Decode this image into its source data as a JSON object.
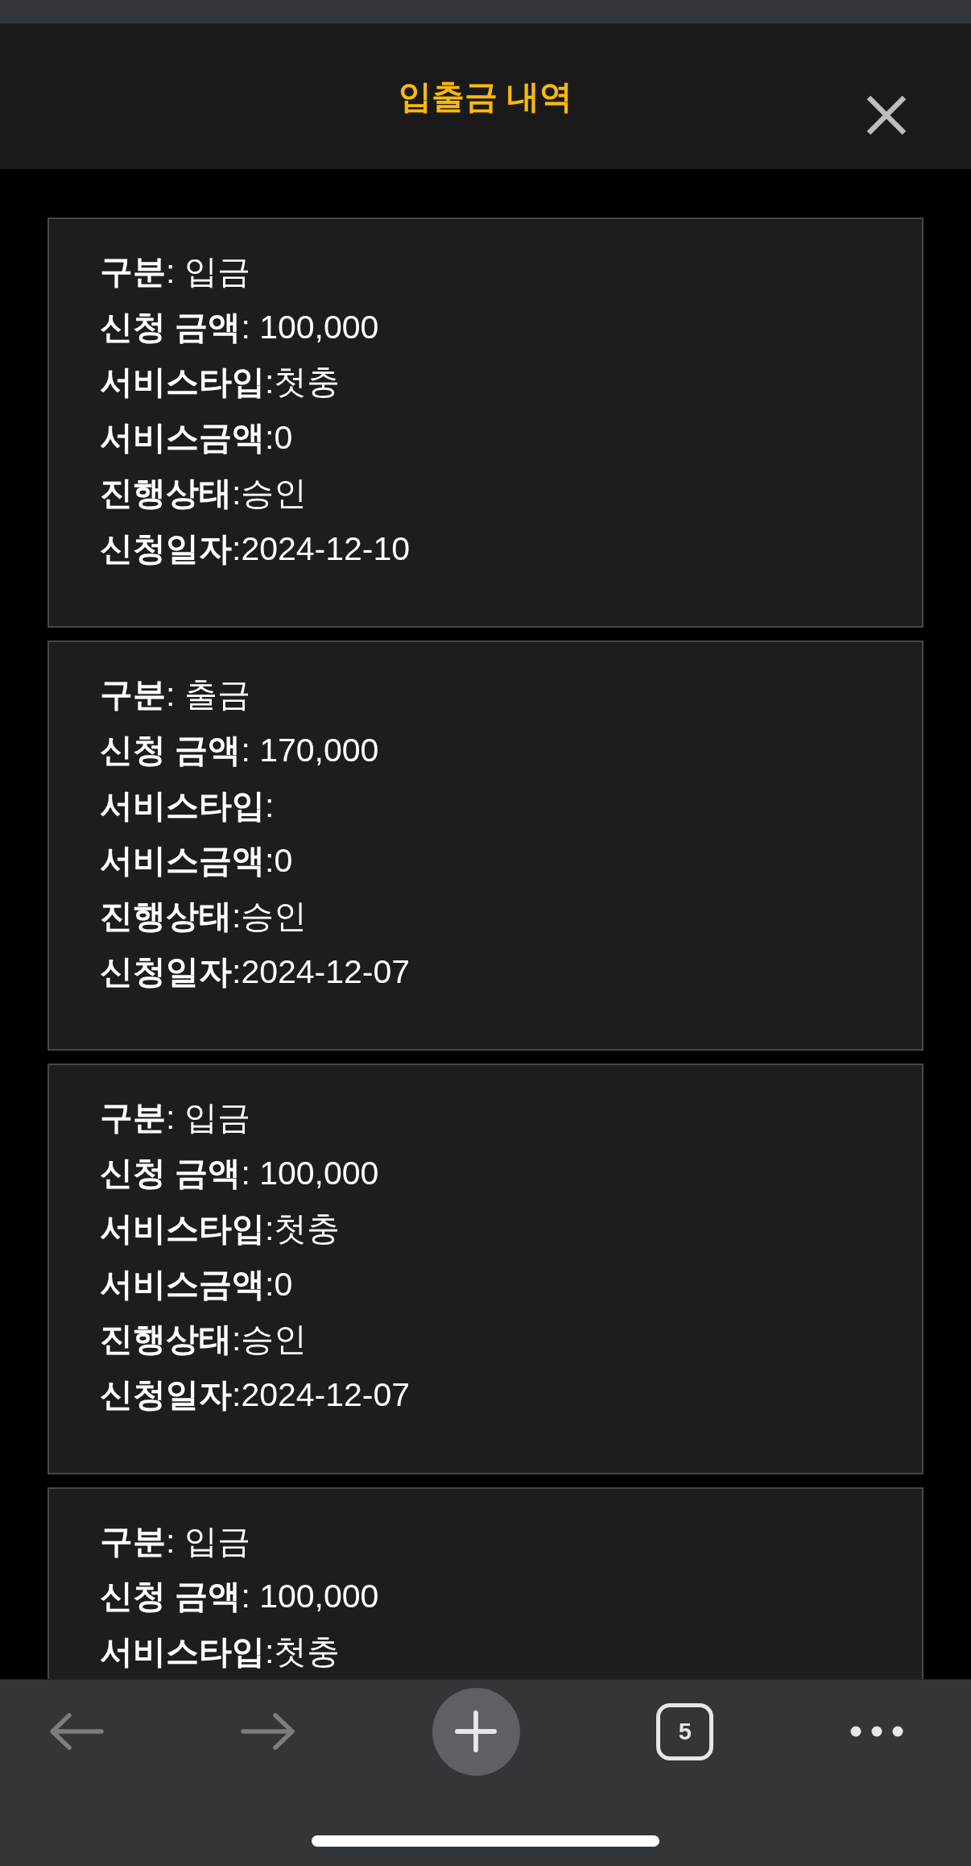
{
  "header": {
    "title": "입출금 내역"
  },
  "transactions": [
    {
      "lines": [
        "**구분**: 입금",
        "**신청 금액**: 100,000",
        "**서비스타입**:첫충",
        "**서비스금액**:0",
        "**진행상태**:승인",
        "**신청일자**:2024-12-10"
      ]
    },
    {
      "lines": [
        "**구분**: 출금",
        "**신청 금액**: 170,000",
        "**서비스타입**:",
        "**서비스금액**:0",
        "**진행상태**:승인",
        "**신청일자**:2024-12-07"
      ]
    },
    {
      "lines": [
        "**구분**: 입금",
        "**신청 금액**: 100,000",
        "**서비스타입**:첫충",
        "**서비스금액**:0",
        "**진행상태**:승인",
        "**신청일자**:2024-12-07"
      ]
    },
    {
      "lines": [
        "**구분**: 입금",
        "**신청 금액**: 100,000",
        "**서비스타입**:첫충"
      ]
    }
  ],
  "toolbar": [
    {
      "kind": "back",
      "disabled": true
    },
    {
      "kind": "forward",
      "disabled": true
    },
    {
      "kind": "new_tab",
      "disabled": false
    },
    {
      "kind": "tabs",
      "label": "5",
      "disabled": false
    },
    {
      "kind": "more",
      "disabled": false
    }
  ]
}
